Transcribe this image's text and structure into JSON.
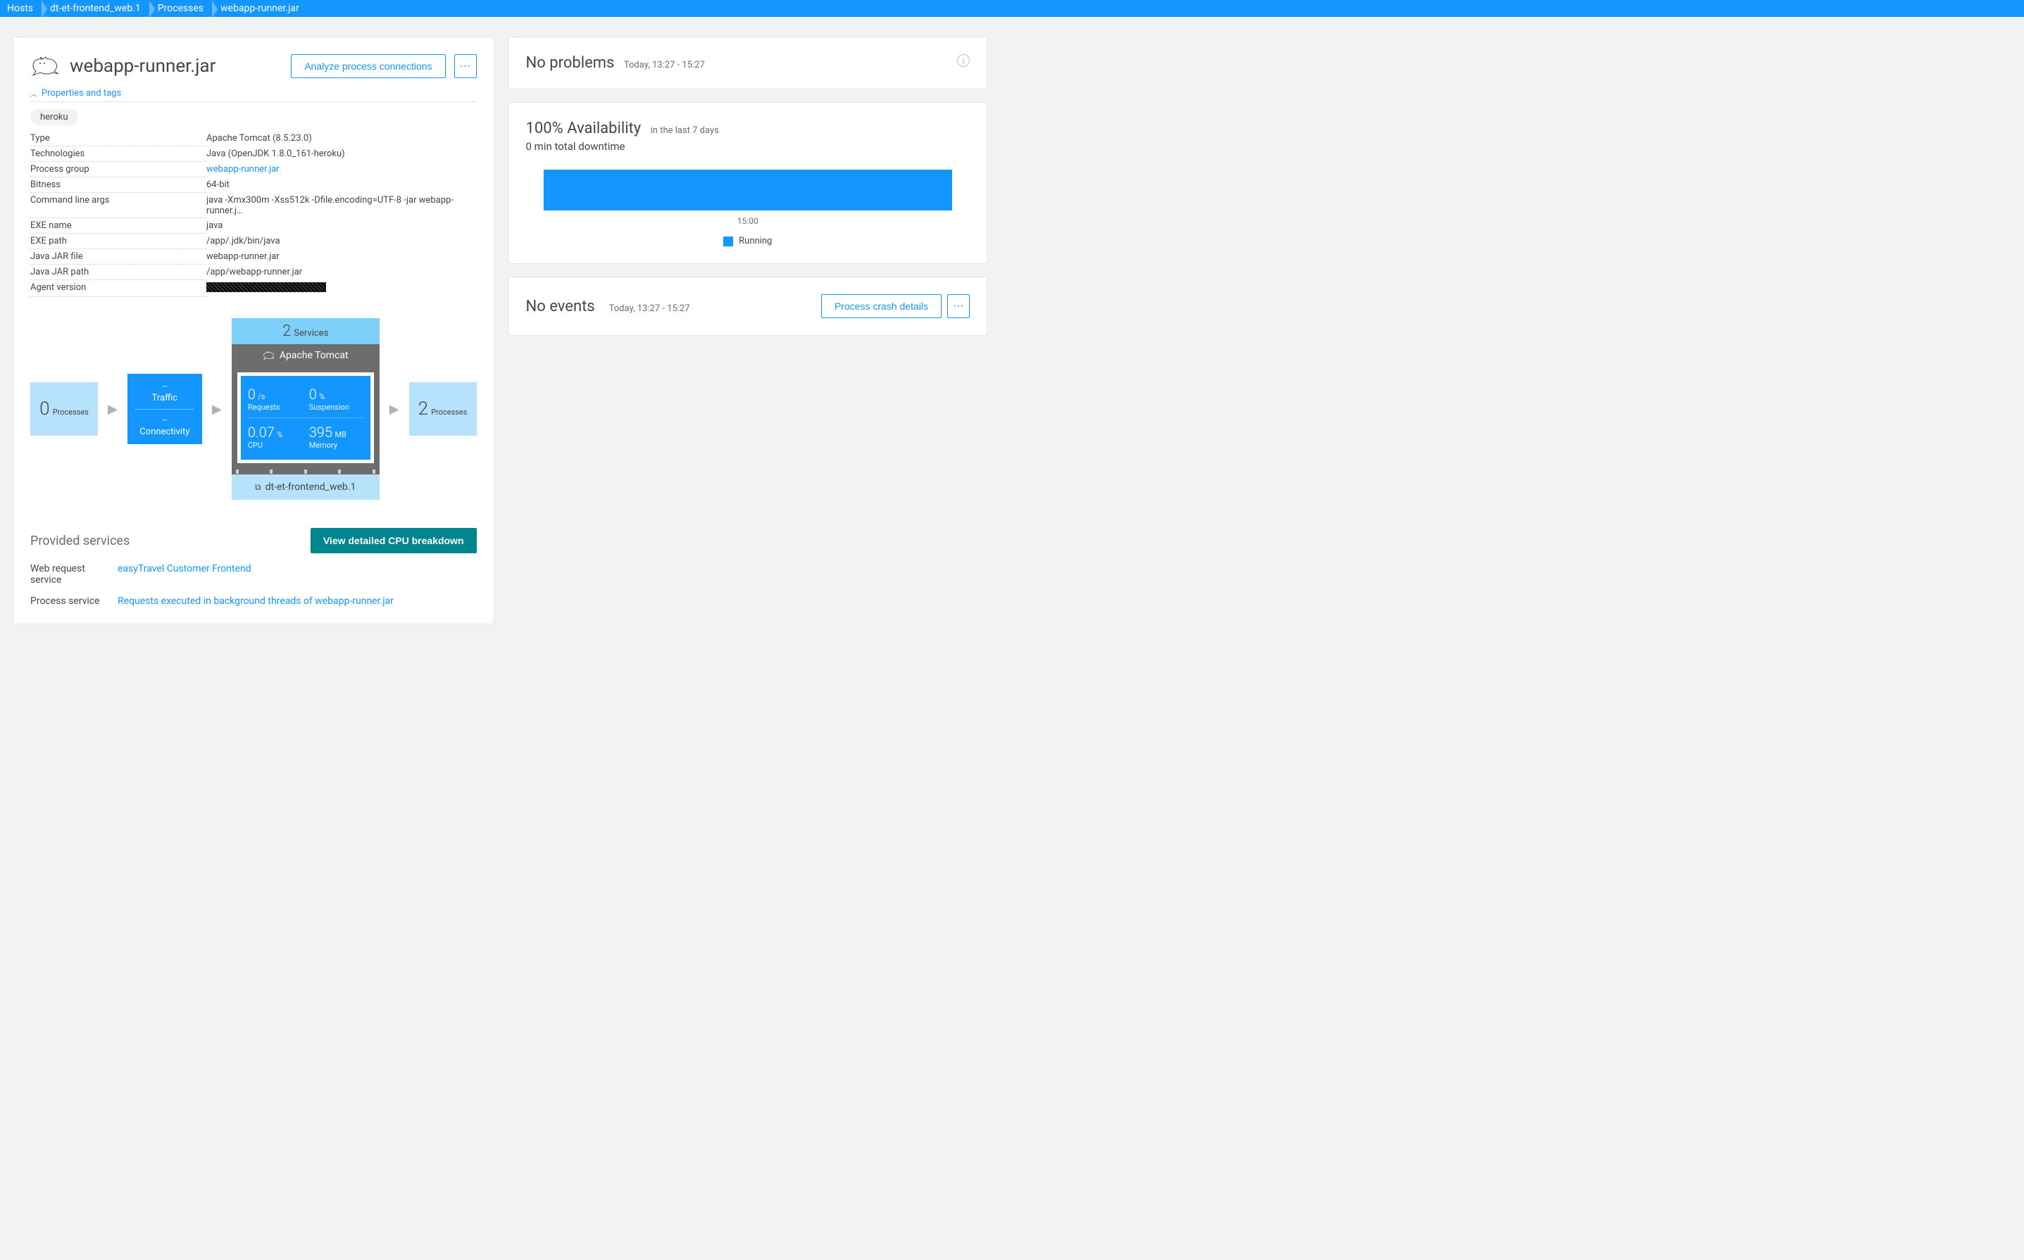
{
  "breadcrumb": [
    "Hosts",
    "dt-et-frontend_web.1",
    "Processes",
    "webapp-runner.jar"
  ],
  "header": {
    "title": "webapp-runner.jar",
    "analyze_btn": "Analyze process connections",
    "more_btn": "···"
  },
  "collapse_label": "Properties and tags",
  "tag": "heroku",
  "properties": [
    {
      "label": "Type",
      "value": "Apache Tomcat (8.5.23.0)"
    },
    {
      "label": "Technologies",
      "value": "Java (OpenJDK 1.8.0_161-heroku)"
    },
    {
      "label": "Process group",
      "value": "webapp-runner.jar",
      "link": true
    },
    {
      "label": "Bitness",
      "value": "64-bit"
    },
    {
      "label": "Command line args",
      "value": "java -Xmx300m -Xss512k -Dfile.encoding=UTF-8 -jar webapp-runner.j…"
    },
    {
      "label": "EXE name",
      "value": "java"
    },
    {
      "label": "EXE path",
      "value": "/app/.jdk/bin/java"
    },
    {
      "label": "Java JAR file",
      "value": "webapp-runner.jar"
    },
    {
      "label": "Java JAR path",
      "value": "/app/webapp-runner.jar"
    },
    {
      "label": "Agent version",
      "value": "",
      "redacted": true
    }
  ],
  "flow": {
    "left_count": "0",
    "left_label": "Processes",
    "traffic_dash": "–",
    "traffic_label": "Traffic",
    "conn_dash": "–",
    "conn_label": "Connectivity",
    "services_count": "2",
    "services_label": "Services",
    "tomcat_label": "Apache Tomcat",
    "metrics": {
      "requests_val": "0",
      "requests_unit": "/s",
      "requests_lbl": "Requests",
      "susp_val": "0",
      "susp_unit": "%",
      "susp_lbl": "Suspension",
      "cpu_val": "0.07",
      "cpu_unit": "%",
      "cpu_lbl": "CPU",
      "mem_val": "395",
      "mem_unit": "MB",
      "mem_lbl": "Memory"
    },
    "host_label": "dt-et-frontend_web.1",
    "right_count": "2",
    "right_label": "Processes"
  },
  "provided": {
    "heading": "Provided services",
    "cpu_btn": "View detailed CPU breakdown",
    "rows": [
      {
        "label": "Web request service",
        "link": "easyTravel Customer Frontend"
      },
      {
        "label": "Process service",
        "link": "Requests executed in background threads of webapp-runner.jar"
      }
    ]
  },
  "problems": {
    "title": "No problems",
    "sub": "Today, 13:27 - 15:27"
  },
  "availability": {
    "title": "100% Availability",
    "sub": "in the last 7 days",
    "downtime": "0 min total downtime",
    "axis": "15:00",
    "legend": "Running"
  },
  "events": {
    "title": "No events",
    "sub": "Today, 13:27 - 15:27",
    "crash_btn": "Process crash details",
    "more_btn": "···"
  },
  "chart_data": {
    "type": "bar",
    "title": "Availability",
    "categories": [
      "15:00"
    ],
    "series": [
      {
        "name": "Running",
        "values": [
          100
        ]
      }
    ],
    "ylim": [
      0,
      100
    ],
    "xlabel": "",
    "ylabel": ""
  }
}
